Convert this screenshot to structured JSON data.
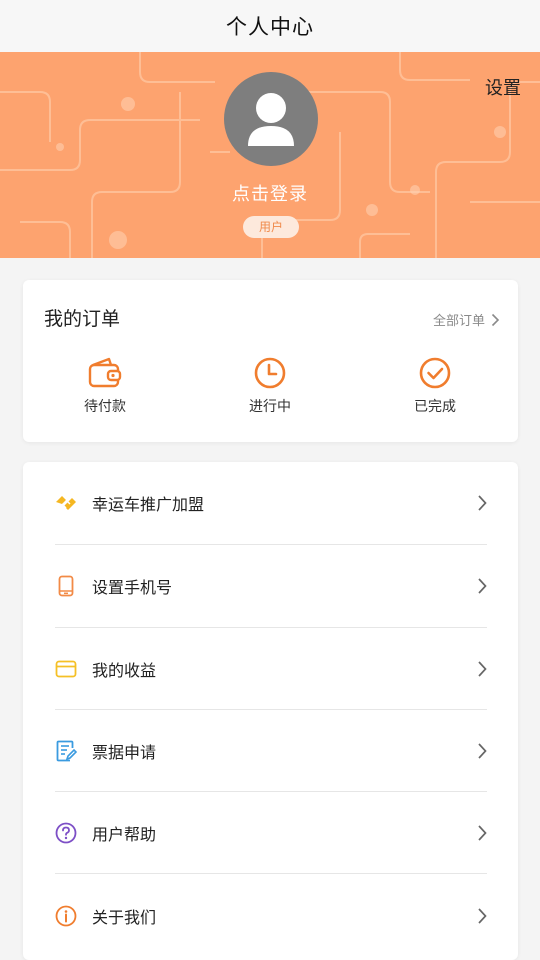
{
  "navbar": {
    "title": "个人中心"
  },
  "profile": {
    "settings_label": "设置",
    "login_text": "点击登录",
    "role_badge": "用户",
    "colors": {
      "banner": "#fda36f",
      "avatar": "#7e7e7e"
    }
  },
  "orders": {
    "title": "我的订单",
    "all_orders_label": "全部订单",
    "items": [
      {
        "label": "待付款",
        "icon": "wallet-icon"
      },
      {
        "label": "进行中",
        "icon": "clock-icon"
      },
      {
        "label": "已完成",
        "icon": "check-circle-icon"
      }
    ],
    "accent_color": "#f07d2e"
  },
  "menu": {
    "items": [
      {
        "label": "幸运车推广加盟",
        "icon": "handshake-icon",
        "color": "#f5b722"
      },
      {
        "label": "设置手机号",
        "icon": "phone-icon",
        "color": "#f28a46"
      },
      {
        "label": "我的收益",
        "icon": "card-icon",
        "color": "#f5c026"
      },
      {
        "label": "票据申请",
        "icon": "document-edit-icon",
        "color": "#3a9be0"
      },
      {
        "label": "用户帮助",
        "icon": "question-icon",
        "color": "#7d4fc6"
      },
      {
        "label": "关于我们",
        "icon": "info-icon",
        "color": "#f07d2e"
      }
    ]
  }
}
